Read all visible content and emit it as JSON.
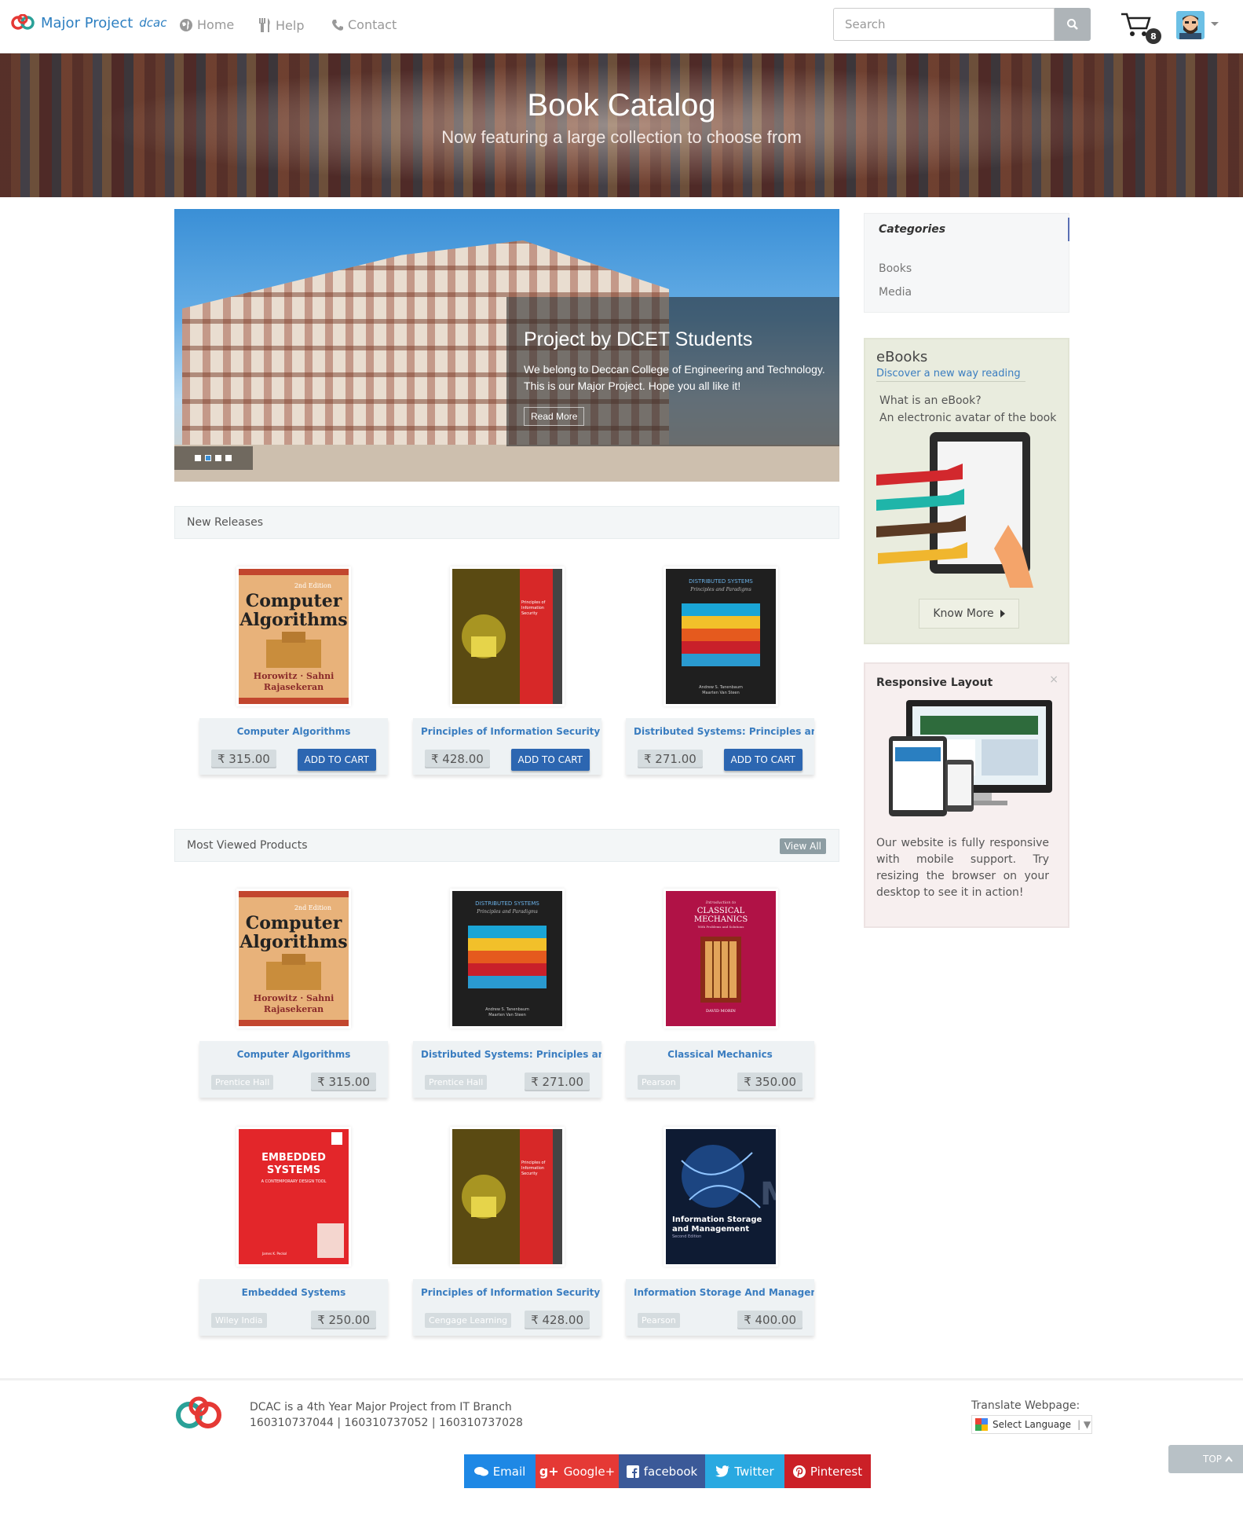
{
  "nav": {
    "brand": "Major Project",
    "brand_tag": "dcac",
    "links": [
      {
        "label": "Home",
        "icon": "globe-icon"
      },
      {
        "label": "Help",
        "icon": "cutlery-icon"
      },
      {
        "label": "Contact",
        "icon": "phone-icon"
      }
    ],
    "search_placeholder": "Search",
    "cart_count": "8"
  },
  "hero": {
    "title": "Book Catalog",
    "subtitle": "Now featuring a large collection to choose from"
  },
  "slider": {
    "title": "Project by DCET Students",
    "text": "We belong to Deccan College of Engineering and Technology. This is our Major Project. Hope you all like it!",
    "button": "Read More"
  },
  "new_releases": {
    "title": "New Releases",
    "products": [
      {
        "title": "Computer Algorithms",
        "price": "₹ 315.00",
        "button": "ADD TO CART",
        "cover": "algorithms"
      },
      {
        "title": "Principles of Information Security",
        "price": "₹ 428.00",
        "button": "ADD TO CART",
        "cover": "security"
      },
      {
        "title": "Distributed Systems: Principles and P",
        "price": "₹ 271.00",
        "button": "ADD TO CART",
        "cover": "distributed"
      }
    ]
  },
  "most_viewed": {
    "title": "Most Viewed Products",
    "view_all": "View All",
    "products": [
      {
        "title": "Computer Algorithms",
        "publisher": "Prentice Hall",
        "price": "₹ 315.00",
        "cover": "algorithms"
      },
      {
        "title": "Distributed Systems: Principles and P",
        "publisher": "Prentice Hall",
        "price": "₹ 271.00",
        "cover": "distributed"
      },
      {
        "title": "Classical Mechanics",
        "publisher": "Pearson",
        "price": "₹ 350.00",
        "cover": "mechanics"
      },
      {
        "title": "Embedded Systems",
        "publisher": "Wiley India",
        "price": "₹ 250.00",
        "cover": "embedded"
      },
      {
        "title": "Principles of Information Security",
        "publisher": "Cengage Learning",
        "price": "₹ 428.00",
        "cover": "security"
      },
      {
        "title": "Information Storage And Managemen",
        "publisher": "Pearson",
        "price": "₹ 400.00",
        "cover": "storage"
      }
    ]
  },
  "covers": {
    "algorithms": {
      "l1": "Computer",
      "l2": "Algorithms",
      "edition": "2nd Edition",
      "authors1": "Horowitz · Sahni",
      "authors2": "Rajasekeran"
    },
    "distributed": {
      "l1": "DISTRIBUTED SYSTEMS",
      "l2": "Principles and Paradigms",
      "authors1": "Andrew S. Tanenbaum",
      "authors2": "Maarten Van Steen"
    },
    "mechanics": {
      "l0": "Introduction to",
      "l1": "CLASSICAL",
      "l2": "MECHANICS",
      "l3": "With Problems and Solutions",
      "author": "DAVID MORIN"
    },
    "embedded": {
      "l1": "EMBEDDED",
      "l2": "SYSTEMS",
      "l3": "A CONTEMPORARY DESIGN TOOL",
      "author": "James K. Peckol"
    },
    "security": {
      "l1": "Principles of",
      "l2": "Information",
      "l3": "Security"
    },
    "storage": {
      "l1": "Information Storage",
      "l2": "and Management",
      "l3": "Second Edition"
    }
  },
  "sidebar": {
    "categories_title": "Categories",
    "categories": [
      "Books",
      "Media"
    ],
    "ebooks": {
      "title": "eBooks",
      "subtitle": "Discover a new way reading",
      "question": "What is an eBook?",
      "answer": "An electronic avatar of the book",
      "button": "Know More"
    },
    "responsive": {
      "title": "Responsive Layout",
      "close": "×",
      "text": "Our website is fully responsive with mobile support. Try resizing the browser on your desktop to see it in action!"
    }
  },
  "footer": {
    "line1": "DCAC is a 4th Year Major Project from IT Branch",
    "line2": "160310737044 | 160310737052 | 160310737028",
    "translate_label": "Translate Webpage:",
    "select_language": "Select Language",
    "social": [
      {
        "label": "Email",
        "color": "#1e88e5",
        "icon": "comments-icon"
      },
      {
        "label": "Google+",
        "color": "#e53935",
        "icon": "google-plus-icon"
      },
      {
        "label": "facebook",
        "color": "#3b5998",
        "icon": "facebook-icon"
      },
      {
        "label": "Twitter",
        "color": "#29a9e1",
        "icon": "twitter-icon"
      },
      {
        "label": "Pinterest",
        "color": "#cb2027",
        "icon": "pinterest-icon"
      }
    ],
    "top": "TOP"
  }
}
